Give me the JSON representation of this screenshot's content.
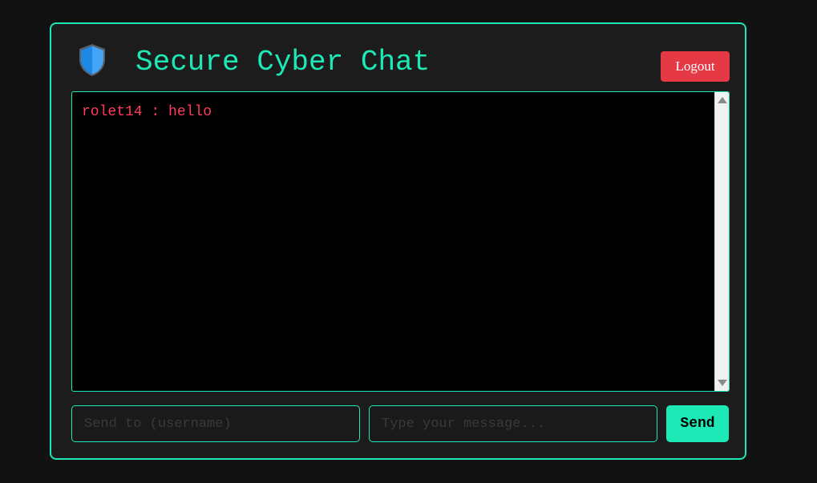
{
  "header": {
    "logo_icon": "shield-icon",
    "title": "Secure Cyber Chat",
    "logout_label": "Logout"
  },
  "chat": {
    "messages": [
      {
        "text": "rolet14 : hello",
        "color": "#ff3b5c"
      }
    ]
  },
  "composer": {
    "recipient_placeholder": "Send to (username)",
    "message_placeholder": "Type your message...",
    "send_label": "Send"
  },
  "colors": {
    "accent": "#1de9b6",
    "danger": "#e53945",
    "background": "#121212",
    "panel": "#1c1c1c"
  }
}
